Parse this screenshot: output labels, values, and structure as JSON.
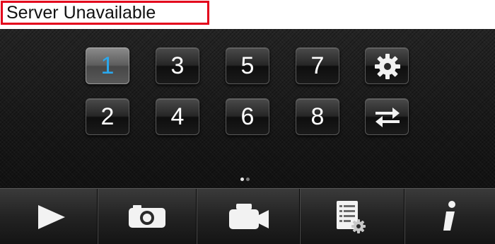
{
  "banner": {
    "error_text": "Server Unavailable"
  },
  "channels": {
    "active": "1",
    "row1": [
      "1",
      "3",
      "5",
      "7"
    ],
    "row2": [
      "2",
      "4",
      "6",
      "8"
    ]
  },
  "icons": {
    "settings": "gear-icon",
    "switch": "swap-arrows-icon",
    "play": "play-icon",
    "snapshot": "camera-icon",
    "record": "video-camera-icon",
    "files": "file-list-settings-icon",
    "info": "info-icon"
  },
  "pagination": {
    "pages": 2,
    "current": 1
  },
  "colors": {
    "active_digit": "#2aa8ee",
    "error_border": "#e3001b"
  }
}
